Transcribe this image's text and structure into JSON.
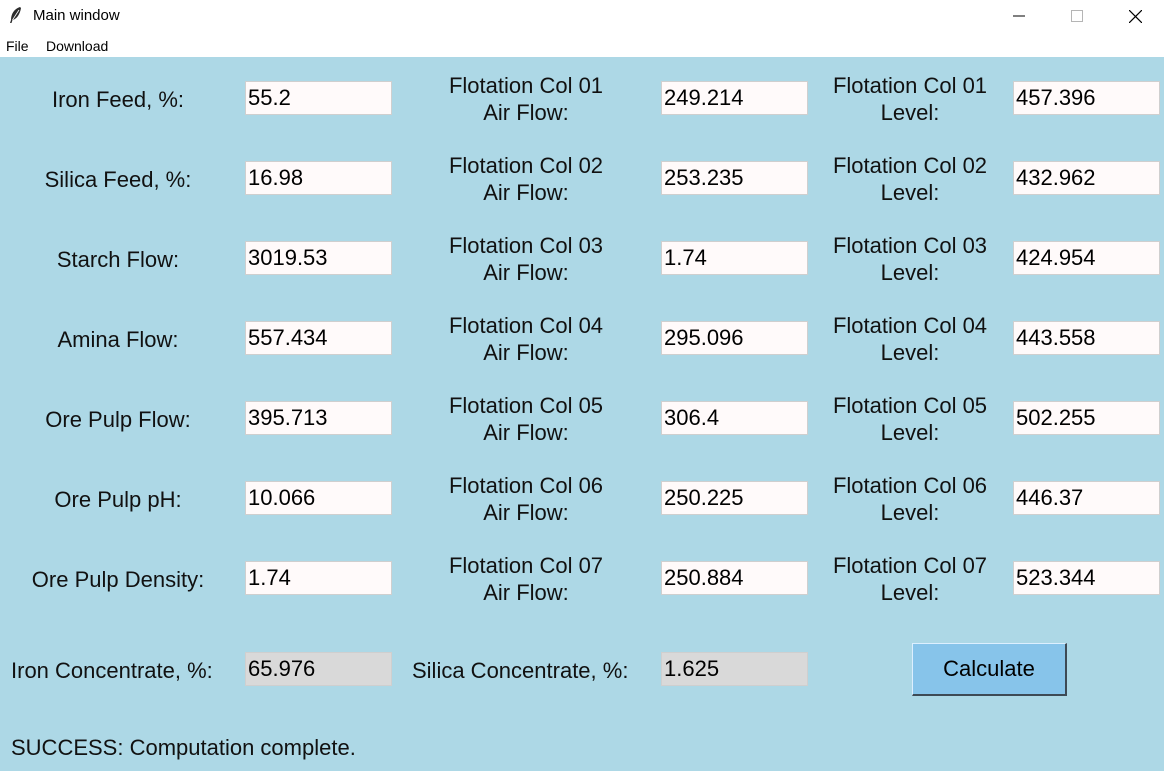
{
  "window": {
    "title": "Main window",
    "icon": "feather-icon"
  },
  "menu": [
    "File",
    "Download"
  ],
  "inputs_left": [
    {
      "label": "Iron Feed, %:",
      "value": "55.2"
    },
    {
      "label": "Silica Feed, %:",
      "value": "16.98"
    },
    {
      "label": "Starch Flow:",
      "value": "3019.53"
    },
    {
      "label": "Amina Flow:",
      "value": "557.434"
    },
    {
      "label": "Ore Pulp Flow:",
      "value": "395.713"
    },
    {
      "label": "Ore Pulp pH:",
      "value": "10.066"
    },
    {
      "label": "Ore Pulp Density:",
      "value": "1.74"
    }
  ],
  "air_flow": [
    {
      "line1": "Flotation Col 01",
      "line2": "Air Flow:",
      "value": "249.214"
    },
    {
      "line1": "Flotation Col 02",
      "line2": "Air Flow:",
      "value": "253.235"
    },
    {
      "line1": "Flotation Col 03",
      "line2": "Air Flow:",
      "value": "1.74"
    },
    {
      "line1": "Flotation Col 04",
      "line2": "Air Flow:",
      "value": "295.096"
    },
    {
      "line1": "Flotation Col 05",
      "line2": "Air Flow:",
      "value": "306.4"
    },
    {
      "line1": "Flotation Col 06",
      "line2": "Air Flow:",
      "value": "250.225"
    },
    {
      "line1": "Flotation Col 07",
      "line2": "Air Flow:",
      "value": "250.884"
    }
  ],
  "level": [
    {
      "line1": "Flotation Col 01",
      "line2": "Level:",
      "value": "457.396"
    },
    {
      "line1": "Flotation Col 02",
      "line2": "Level:",
      "value": "432.962"
    },
    {
      "line1": "Flotation Col 03",
      "line2": "Level:",
      "value": "424.954"
    },
    {
      "line1": "Flotation Col 04",
      "line2": "Level:",
      "value": "443.558"
    },
    {
      "line1": "Flotation Col 05",
      "line2": "Level:",
      "value": "502.255"
    },
    {
      "line1": "Flotation Col 06",
      "line2": "Level:",
      "value": "446.37"
    },
    {
      "line1": "Flotation Col 07",
      "line2": "Level:",
      "value": "523.344"
    }
  ],
  "outputs": {
    "iron_label": "Iron Concentrate, %:",
    "iron_value": "65.976",
    "silica_label": "Silica Concentrate, %:",
    "silica_value": "1.625"
  },
  "calculate_label": "Calculate",
  "status": "SUCCESS: Computation complete.",
  "colors": {
    "background": "#add8e6",
    "field": "#fffafa",
    "readonly_field": "#d9d9d9",
    "button": "#87c4ea"
  }
}
